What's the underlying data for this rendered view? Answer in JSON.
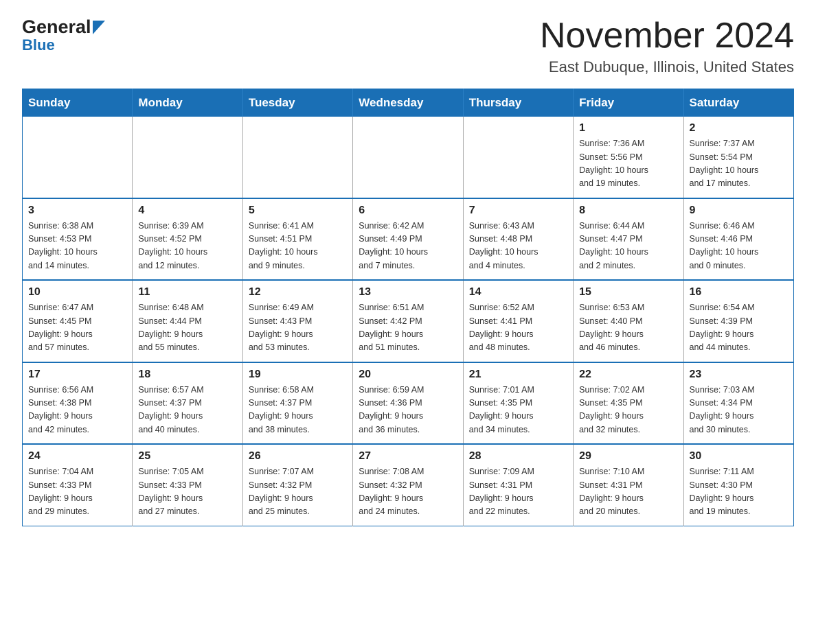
{
  "header": {
    "logo_general": "General",
    "logo_blue": "Blue",
    "month_title": "November 2024",
    "location": "East Dubuque, Illinois, United States"
  },
  "weekdays": [
    "Sunday",
    "Monday",
    "Tuesday",
    "Wednesday",
    "Thursday",
    "Friday",
    "Saturday"
  ],
  "weeks": [
    [
      {
        "day": "",
        "info": ""
      },
      {
        "day": "",
        "info": ""
      },
      {
        "day": "",
        "info": ""
      },
      {
        "day": "",
        "info": ""
      },
      {
        "day": "",
        "info": ""
      },
      {
        "day": "1",
        "info": "Sunrise: 7:36 AM\nSunset: 5:56 PM\nDaylight: 10 hours\nand 19 minutes."
      },
      {
        "day": "2",
        "info": "Sunrise: 7:37 AM\nSunset: 5:54 PM\nDaylight: 10 hours\nand 17 minutes."
      }
    ],
    [
      {
        "day": "3",
        "info": "Sunrise: 6:38 AM\nSunset: 4:53 PM\nDaylight: 10 hours\nand 14 minutes."
      },
      {
        "day": "4",
        "info": "Sunrise: 6:39 AM\nSunset: 4:52 PM\nDaylight: 10 hours\nand 12 minutes."
      },
      {
        "day": "5",
        "info": "Sunrise: 6:41 AM\nSunset: 4:51 PM\nDaylight: 10 hours\nand 9 minutes."
      },
      {
        "day": "6",
        "info": "Sunrise: 6:42 AM\nSunset: 4:49 PM\nDaylight: 10 hours\nand 7 minutes."
      },
      {
        "day": "7",
        "info": "Sunrise: 6:43 AM\nSunset: 4:48 PM\nDaylight: 10 hours\nand 4 minutes."
      },
      {
        "day": "8",
        "info": "Sunrise: 6:44 AM\nSunset: 4:47 PM\nDaylight: 10 hours\nand 2 minutes."
      },
      {
        "day": "9",
        "info": "Sunrise: 6:46 AM\nSunset: 4:46 PM\nDaylight: 10 hours\nand 0 minutes."
      }
    ],
    [
      {
        "day": "10",
        "info": "Sunrise: 6:47 AM\nSunset: 4:45 PM\nDaylight: 9 hours\nand 57 minutes."
      },
      {
        "day": "11",
        "info": "Sunrise: 6:48 AM\nSunset: 4:44 PM\nDaylight: 9 hours\nand 55 minutes."
      },
      {
        "day": "12",
        "info": "Sunrise: 6:49 AM\nSunset: 4:43 PM\nDaylight: 9 hours\nand 53 minutes."
      },
      {
        "day": "13",
        "info": "Sunrise: 6:51 AM\nSunset: 4:42 PM\nDaylight: 9 hours\nand 51 minutes."
      },
      {
        "day": "14",
        "info": "Sunrise: 6:52 AM\nSunset: 4:41 PM\nDaylight: 9 hours\nand 48 minutes."
      },
      {
        "day": "15",
        "info": "Sunrise: 6:53 AM\nSunset: 4:40 PM\nDaylight: 9 hours\nand 46 minutes."
      },
      {
        "day": "16",
        "info": "Sunrise: 6:54 AM\nSunset: 4:39 PM\nDaylight: 9 hours\nand 44 minutes."
      }
    ],
    [
      {
        "day": "17",
        "info": "Sunrise: 6:56 AM\nSunset: 4:38 PM\nDaylight: 9 hours\nand 42 minutes."
      },
      {
        "day": "18",
        "info": "Sunrise: 6:57 AM\nSunset: 4:37 PM\nDaylight: 9 hours\nand 40 minutes."
      },
      {
        "day": "19",
        "info": "Sunrise: 6:58 AM\nSunset: 4:37 PM\nDaylight: 9 hours\nand 38 minutes."
      },
      {
        "day": "20",
        "info": "Sunrise: 6:59 AM\nSunset: 4:36 PM\nDaylight: 9 hours\nand 36 minutes."
      },
      {
        "day": "21",
        "info": "Sunrise: 7:01 AM\nSunset: 4:35 PM\nDaylight: 9 hours\nand 34 minutes."
      },
      {
        "day": "22",
        "info": "Sunrise: 7:02 AM\nSunset: 4:35 PM\nDaylight: 9 hours\nand 32 minutes."
      },
      {
        "day": "23",
        "info": "Sunrise: 7:03 AM\nSunset: 4:34 PM\nDaylight: 9 hours\nand 30 minutes."
      }
    ],
    [
      {
        "day": "24",
        "info": "Sunrise: 7:04 AM\nSunset: 4:33 PM\nDaylight: 9 hours\nand 29 minutes."
      },
      {
        "day": "25",
        "info": "Sunrise: 7:05 AM\nSunset: 4:33 PM\nDaylight: 9 hours\nand 27 minutes."
      },
      {
        "day": "26",
        "info": "Sunrise: 7:07 AM\nSunset: 4:32 PM\nDaylight: 9 hours\nand 25 minutes."
      },
      {
        "day": "27",
        "info": "Sunrise: 7:08 AM\nSunset: 4:32 PM\nDaylight: 9 hours\nand 24 minutes."
      },
      {
        "day": "28",
        "info": "Sunrise: 7:09 AM\nSunset: 4:31 PM\nDaylight: 9 hours\nand 22 minutes."
      },
      {
        "day": "29",
        "info": "Sunrise: 7:10 AM\nSunset: 4:31 PM\nDaylight: 9 hours\nand 20 minutes."
      },
      {
        "day": "30",
        "info": "Sunrise: 7:11 AM\nSunset: 4:30 PM\nDaylight: 9 hours\nand 19 minutes."
      }
    ]
  ]
}
